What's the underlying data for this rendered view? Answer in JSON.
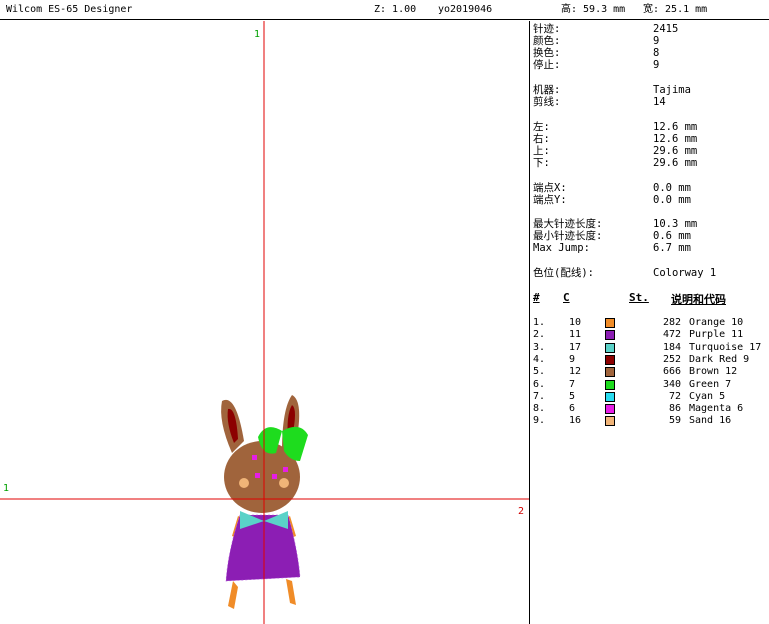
{
  "titlebar": {
    "app": "Wilcom ES-65 Designer",
    "zoom": "Z: 1.00",
    "file": "yo2019046",
    "height": "高: 59.3 mm",
    "width": "宽: 25.1 mm"
  },
  "canvas": {
    "axis_markers": {
      "top": "1",
      "left": "1",
      "right": "2"
    }
  },
  "info": {
    "stats": [
      {
        "label": "针迹:",
        "value": "2415"
      },
      {
        "label": "颜色:",
        "value": "9"
      },
      {
        "label": "换色:",
        "value": "8"
      },
      {
        "label": "停止:",
        "value": "9"
      },
      {
        "label": "机器:",
        "value": "Tajima"
      },
      {
        "label": "剪线:",
        "value": "14"
      },
      {
        "label": "左:",
        "value": "12.6 mm"
      },
      {
        "label": "右:",
        "value": "12.6 mm"
      },
      {
        "label": "上:",
        "value": "29.6 mm"
      },
      {
        "label": "下:",
        "value": "29.6 mm"
      },
      {
        "label": "端点X:",
        "value": "0.0 mm"
      },
      {
        "label": "端点Y:",
        "value": "0.0 mm"
      },
      {
        "label": "最大针迹长度:",
        "value": "10.3 mm"
      },
      {
        "label": "最小针迹长度:",
        "value": "0.6 mm"
      },
      {
        "label": "Max Jump:",
        "value": "6.7 mm"
      },
      {
        "label": "色位(配线):",
        "value": "Colorway 1"
      }
    ],
    "color_headers": {
      "num": "#",
      "code": "C",
      "stitches": "St.",
      "desc": "说明和代码"
    },
    "colors": [
      {
        "idx": "1.",
        "code": "10",
        "color": "#f08c28",
        "stitches": "282",
        "name": "Orange 10"
      },
      {
        "idx": "2.",
        "code": "11",
        "color": "#8c1eb4",
        "stitches": "472",
        "name": "Purple 11"
      },
      {
        "idx": "3.",
        "code": "17",
        "color": "#5ad2c8",
        "stitches": "184",
        "name": "Turquoise 17"
      },
      {
        "idx": "4.",
        "code": "9",
        "color": "#8c0000",
        "stitches": "252",
        "name": "Dark Red 9"
      },
      {
        "idx": "5.",
        "code": "12",
        "color": "#a0643c",
        "stitches": "666",
        "name": "Brown 12"
      },
      {
        "idx": "6.",
        "code": "7",
        "color": "#1edc1e",
        "stitches": "340",
        "name": "Green 7"
      },
      {
        "idx": "7.",
        "code": "5",
        "color": "#28dcf0",
        "stitches": "72",
        "name": "Cyan 5"
      },
      {
        "idx": "8.",
        "code": "6",
        "color": "#e61ee6",
        "stitches": "86",
        "name": "Magenta 6"
      },
      {
        "idx": "9.",
        "code": "16",
        "color": "#f0b478",
        "stitches": "59",
        "name": "Sand 16"
      }
    ]
  }
}
